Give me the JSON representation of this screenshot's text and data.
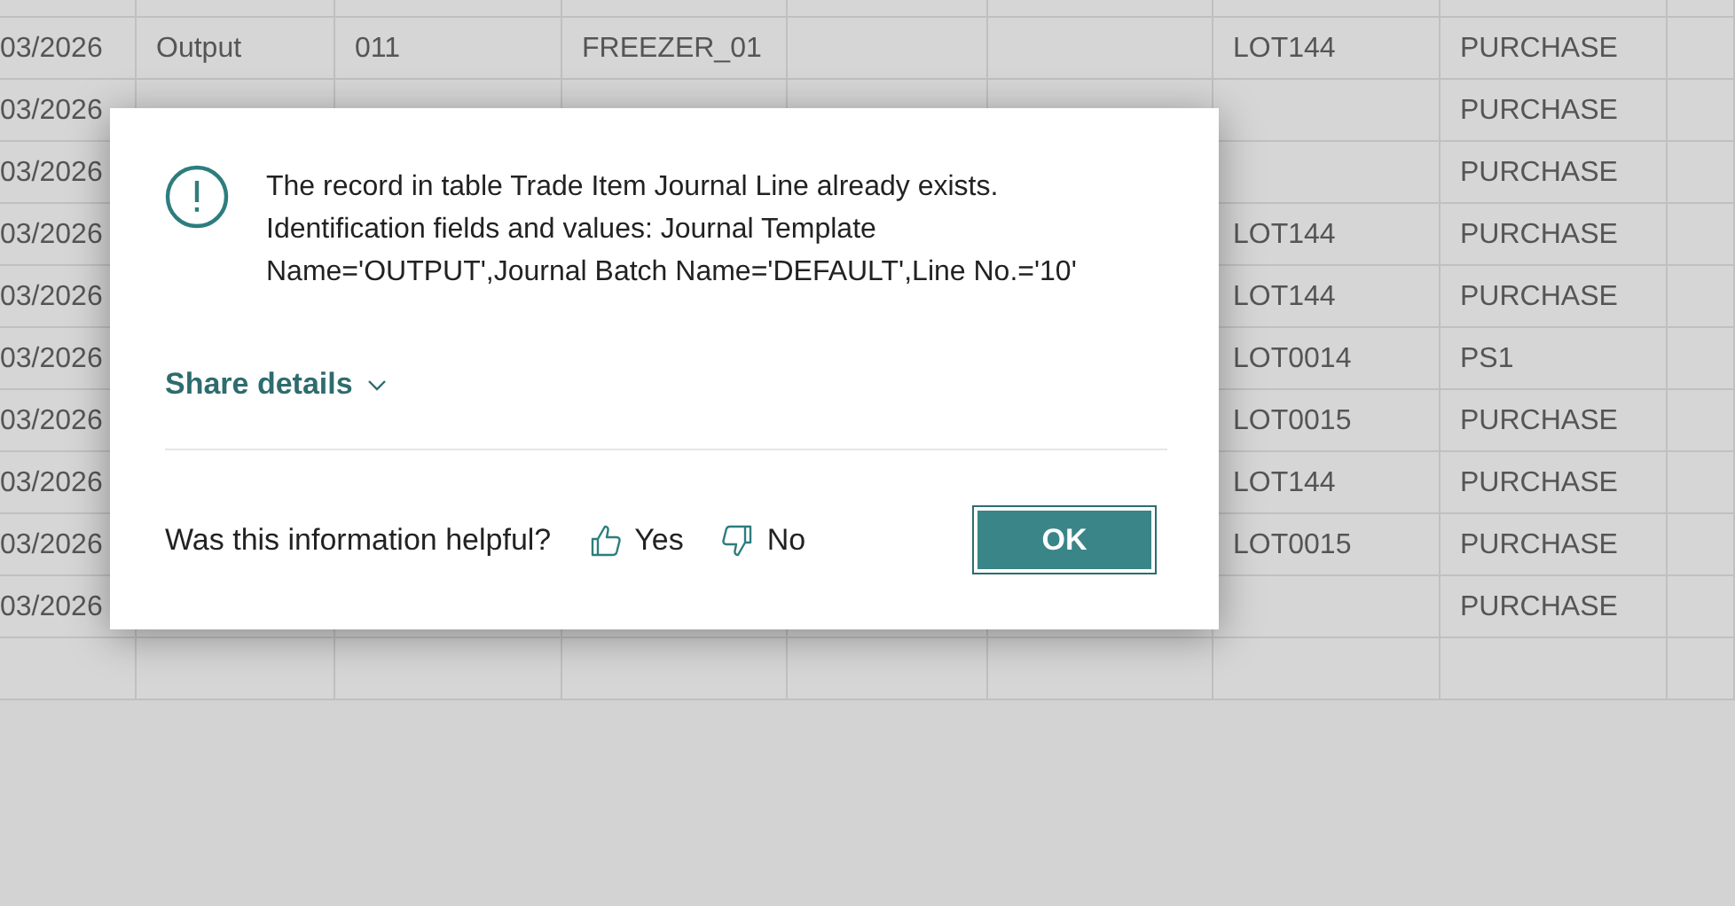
{
  "table": {
    "rows": [
      {
        "column_1": "03/2026",
        "column_2": "Output",
        "column_3": "011",
        "column_4": "FREEZER_01",
        "column_7": "LOT144",
        "column_8": "PURCHASE"
      },
      {
        "column_1": "03/2026",
        "column_8": "PURCHASE"
      },
      {
        "column_1": "03/2026",
        "column_8": "PURCHASE"
      },
      {
        "column_1": "03/2026",
        "column_7": "LOT144",
        "column_8": "PURCHASE"
      },
      {
        "column_1": "03/2026",
        "column_7": "LOT144",
        "column_8": "PURCHASE"
      },
      {
        "column_1": "03/2026",
        "column_7": "LOT0014",
        "column_8": "PS1"
      },
      {
        "column_1": "03/2026",
        "column_7": "LOT0015",
        "column_8": "PURCHASE"
      },
      {
        "column_1": "03/2026",
        "column_7": "LOT144",
        "column_8": "PURCHASE"
      },
      {
        "column_1": "03/2026",
        "column_7": "LOT0015",
        "column_8": "PURCHASE"
      },
      {
        "column_1": "03/2026",
        "column_8": "PURCHASE"
      },
      {}
    ]
  },
  "dialog": {
    "message": "The record in table Trade Item Journal Line already exists. Identification fields and values: Journal Template Name='OUTPUT',Journal Batch Name='DEFAULT',Line No.='10'",
    "share_details": {
      "label": "Share details",
      "expanded": false
    },
    "feedback": {
      "question": "Was this information helpful?",
      "yes": "Yes",
      "no": "No"
    },
    "ok_button": "OK"
  }
}
